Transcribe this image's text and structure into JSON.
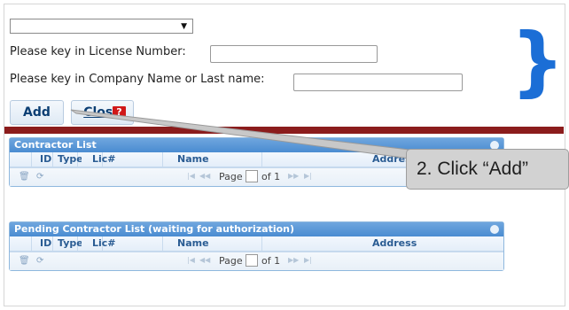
{
  "form": {
    "select_value": "",
    "select_arrow": "▼",
    "license_label": "Please key in License Number:",
    "license_value": "",
    "company_label": "Please key in Company Name or Last name:",
    "company_value": "",
    "add_label": "Add",
    "close_label": "Close",
    "help_icon": "?"
  },
  "contractor_list": {
    "title": "Contractor List",
    "columns": [
      "ID",
      "Type",
      "Lic#",
      "Name",
      "Address"
    ],
    "pager": {
      "page_label": "Page",
      "of_label": "of 1",
      "first": "|◀",
      "prev": "◀◀",
      "next": "▶▶",
      "last": "▶|"
    }
  },
  "pending_list": {
    "title": "Pending Contractor List (waiting for authorization)",
    "columns": [
      "ID",
      "Type",
      "Lic#",
      "Name",
      "Address"
    ],
    "pager": {
      "page_label": "Page",
      "of_label": "of 1",
      "first": "|◀",
      "prev": "◀◀",
      "next": "▶▶",
      "last": "▶|"
    }
  },
  "annotation": {
    "callout_text": "2. Click “Add”",
    "brace": "}",
    "brace_color": "#1b6ed6"
  },
  "colors": {
    "divider": "#8b1c1c",
    "grid_caption": "#4a8cd1",
    "button_text": "#0b3e73"
  }
}
